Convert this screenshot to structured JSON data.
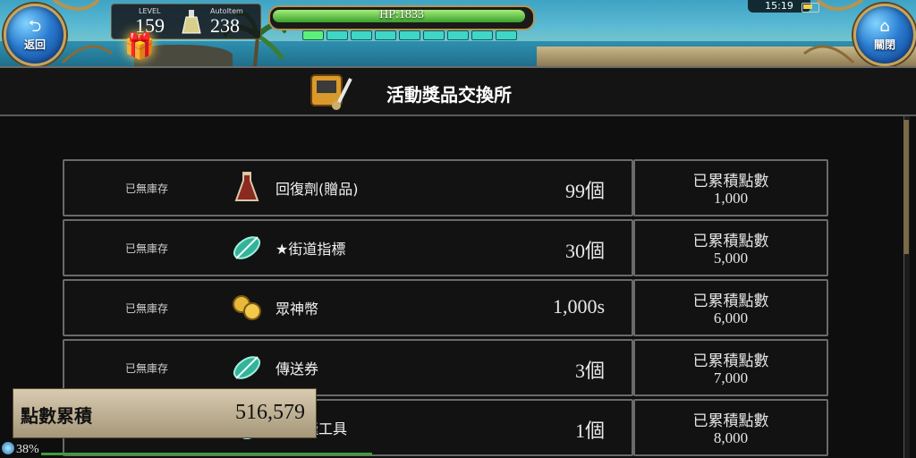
{
  "hud": {
    "back_label": "返回",
    "close_label": "關閉",
    "level_caption": "LEVEL",
    "level_value": "159",
    "autoitem_caption": "AutoItem",
    "autoitem_value": "238",
    "hp_text": "HP:1833",
    "hp_fraction": 0.98,
    "energy_segments": 9,
    "energy_filled": 1,
    "clock": "15:19",
    "icons": {
      "back": "back-arrow-icon",
      "close": "home-icon",
      "gift": "gift-icon",
      "battery": "battery-icon",
      "potion": "potion-icon"
    }
  },
  "page": {
    "title": "活動獎品交換所",
    "title_icon": "shop-sword-icon"
  },
  "items": [
    {
      "stock": "已無庫存",
      "icon": "red-potion-icon",
      "name": "回復劑(贈品)",
      "qty": "99個",
      "points_label": "已累積點數",
      "points": "1,000"
    },
    {
      "stock": "已無庫存",
      "icon": "green-feather-icon",
      "name": "★街道指標",
      "qty": "30個",
      "points_label": "已累積點數",
      "points": "5,000"
    },
    {
      "stock": "已無庫存",
      "icon": "gold-coins-icon",
      "name": "眾神幣",
      "qty": "1,000s",
      "points_label": "已累積點數",
      "points": "6,000"
    },
    {
      "stock": "已無庫存",
      "icon": "green-feather-icon",
      "name": "傳送券",
      "qty": "3個",
      "points_label": "已累積點數",
      "points": "7,000"
    },
    {
      "stock": "",
      "icon": "tool-icon",
      "name": "的裁縫工具",
      "qty": "1個",
      "points_label": "已累積點數",
      "points": "8,000"
    }
  ],
  "points_panel": {
    "label": "點數累積",
    "value": "516,579"
  },
  "footer": {
    "percent": "38%"
  }
}
